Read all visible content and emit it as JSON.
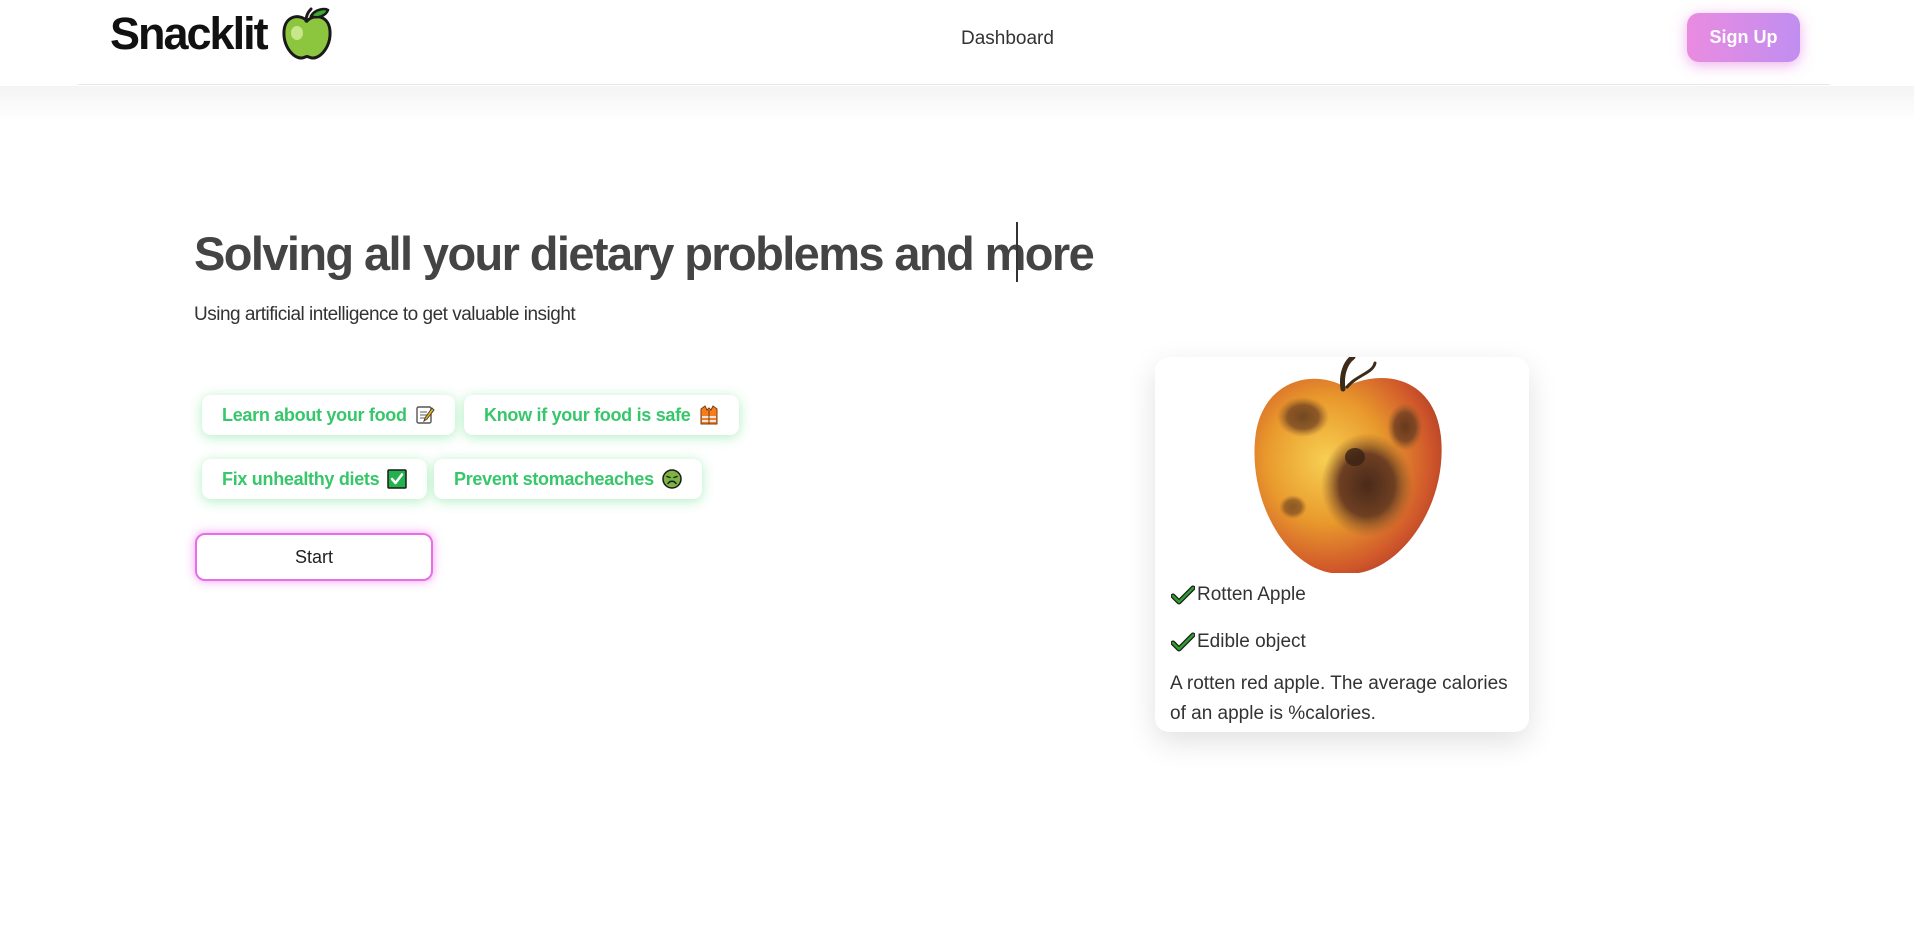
{
  "brand": {
    "name": "Snacklit",
    "logo_icon": "green-apple-icon"
  },
  "nav": {
    "link_label": "Dashboard",
    "signup_label": "Sign Up"
  },
  "hero": {
    "title": "Solving all your dietary problems and more",
    "subtitle": "Using artificial intelligence to get valuable insight",
    "chips": [
      {
        "label": "Learn about your food",
        "icon": "memo-icon"
      },
      {
        "label": "Know if your food is safe",
        "icon": "safety-vest-icon"
      },
      {
        "label": "Fix unhealthy diets",
        "icon": "check-box-icon"
      },
      {
        "label": "Prevent stomacheaches",
        "icon": "nauseated-face-icon"
      }
    ],
    "start_label": "Start"
  },
  "result_card": {
    "image_icon": "rotten-apple-image",
    "items": [
      {
        "icon": "check-mark-icon",
        "label": "Rotten Apple"
      },
      {
        "icon": "check-mark-icon",
        "label": "Edible object"
      }
    ],
    "description": "A rotten red apple. The average calories of an apple is %calories."
  },
  "colors": {
    "chip_text": "#36c76b",
    "signup_gradient_start": "#ea8be0",
    "signup_gradient_end": "#c08ef0",
    "start_border": "#e86ee8",
    "check_green": "#2e9e2e"
  }
}
